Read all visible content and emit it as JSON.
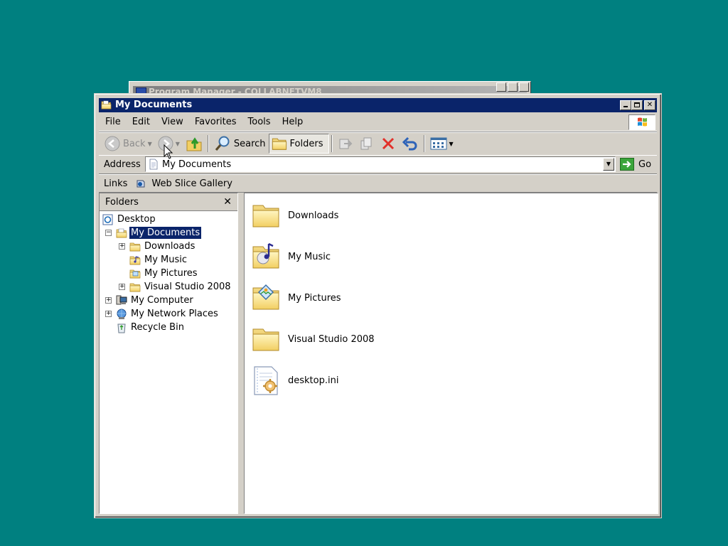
{
  "background_window": {
    "title": "Program Manager - COLLABNETVM8"
  },
  "window": {
    "title": "My Documents"
  },
  "menu": [
    "File",
    "Edit",
    "View",
    "Favorites",
    "Tools",
    "Help"
  ],
  "toolbar": {
    "back_label": "Back",
    "search_label": "Search",
    "folders_label": "Folders"
  },
  "address": {
    "label": "Address",
    "value": "My Documents",
    "go_label": "Go"
  },
  "links": {
    "label": "Links",
    "items": [
      "Web Slice Gallery"
    ]
  },
  "folders_pane": {
    "title": "Folders",
    "tree": [
      {
        "label": "Desktop",
        "icon": "desktop-icon"
      },
      {
        "label": "My Documents",
        "icon": "my-documents-icon",
        "selected": true,
        "expander": "−"
      },
      {
        "label": "Downloads",
        "icon": "folder-icon",
        "expander": "+"
      },
      {
        "label": "My Music",
        "icon": "music-folder-icon"
      },
      {
        "label": "My Pictures",
        "icon": "pictures-folder-icon"
      },
      {
        "label": "Visual Studio 2008",
        "icon": "folder-icon",
        "expander": "+"
      },
      {
        "label": "My Computer",
        "icon": "my-computer-icon",
        "expander": "+"
      },
      {
        "label": "My Network Places",
        "icon": "network-places-icon",
        "expander": "+"
      },
      {
        "label": "Recycle Bin",
        "icon": "recycle-bin-icon"
      }
    ]
  },
  "files": [
    {
      "name": "Downloads",
      "icon": "folder-icon"
    },
    {
      "name": "My Music",
      "icon": "music-folder-icon"
    },
    {
      "name": "My Pictures",
      "icon": "pictures-folder-icon"
    },
    {
      "name": "Visual Studio 2008",
      "icon": "folder-icon"
    },
    {
      "name": "desktop.ini",
      "icon": "settings-file-icon"
    }
  ],
  "colors": {
    "desktop": "#008080",
    "titlebar": "#0a246a",
    "chrome": "#d4d0c8"
  }
}
